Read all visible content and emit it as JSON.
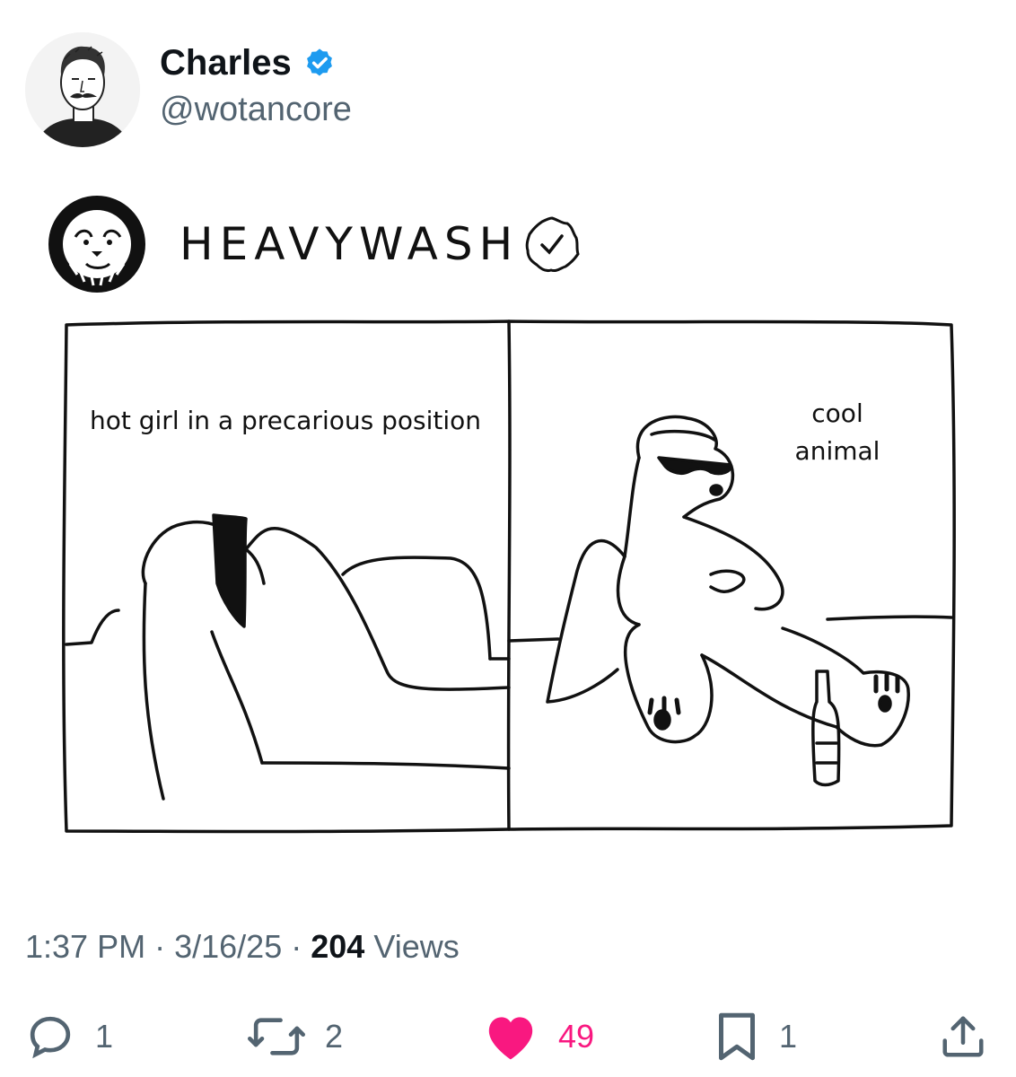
{
  "author": {
    "name": "Charles",
    "handle": "@wotancore"
  },
  "comic": {
    "brand": "HEAVYWASH",
    "panel_left_caption": "hot girl in a precarious position",
    "panel_right_caption": "cool animal"
  },
  "meta": {
    "time": "1:37 PM",
    "date": "3/16/25",
    "separator": "·",
    "views_count": "204",
    "views_label": "Views"
  },
  "actions": {
    "replies": "1",
    "reposts": "2",
    "likes": "49",
    "bookmarks": "1"
  },
  "colors": {
    "verified": "#1d9bf0",
    "like": "#f91880",
    "secondary_text": "#536471"
  },
  "icons": [
    "verified-badge-icon",
    "reply-icon",
    "repost-icon",
    "heart-icon",
    "bookmark-icon",
    "share-icon"
  ]
}
